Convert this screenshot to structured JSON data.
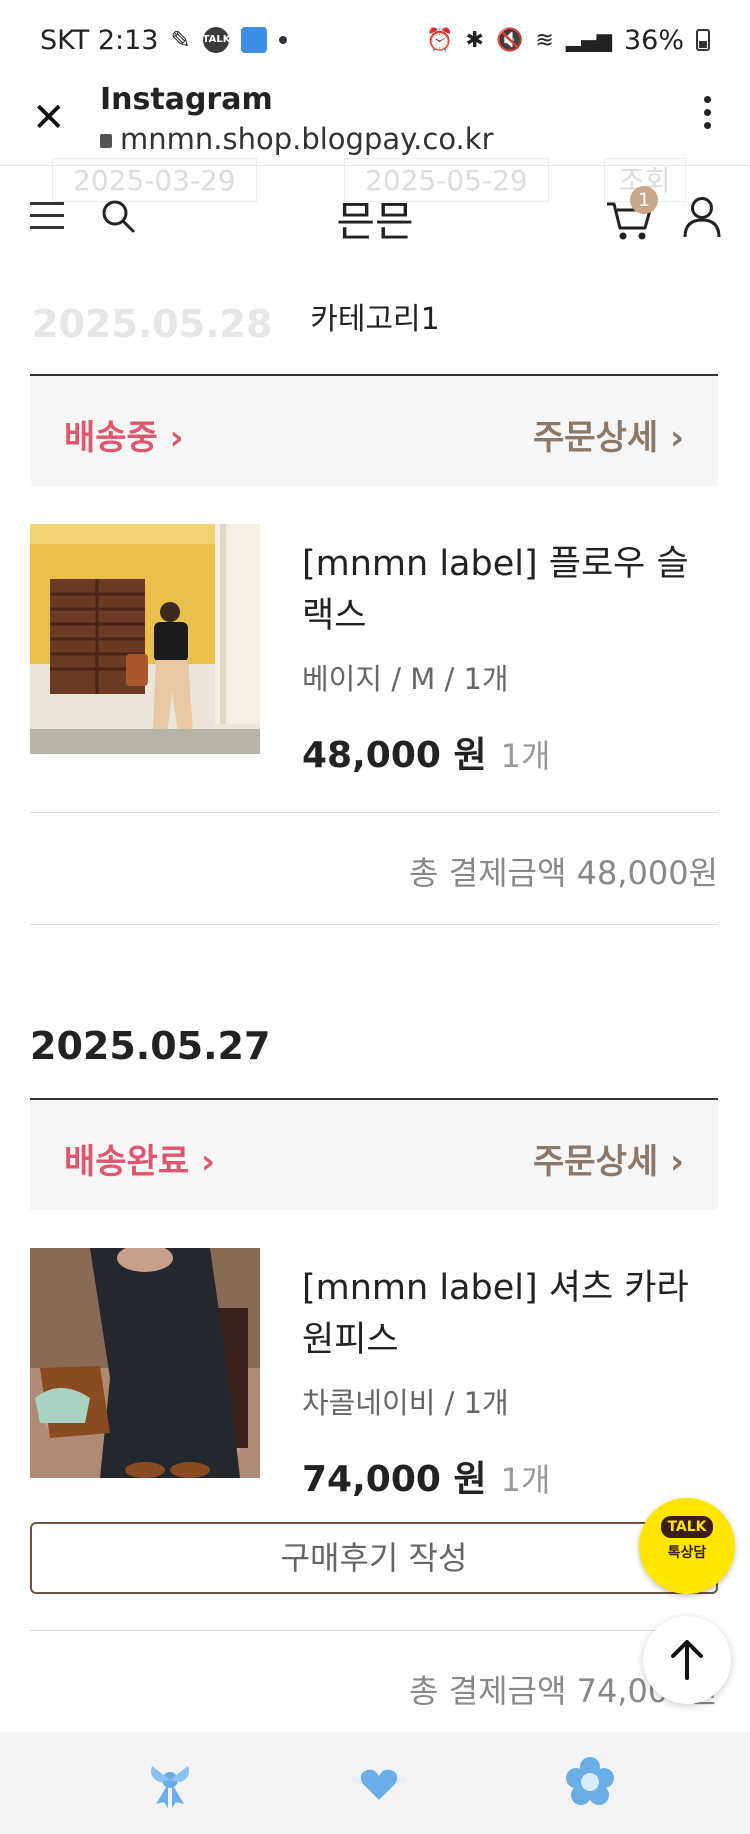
{
  "status_bar": {
    "carrier_time": "SKT 2:13",
    "talk_icon_text": "TALK",
    "battery": "36%"
  },
  "browser": {
    "title": "Instagram",
    "url": "mnmn.shop.blogpay.co.kr"
  },
  "shop": {
    "logo": "믄믄",
    "cart_count": "1",
    "category": "카테고리1",
    "search_date_from": "2025-03-29",
    "search_date_to": "2025-05-29",
    "search_button": "조회",
    "first_date": "2025.05.28"
  },
  "orders": [
    {
      "date": "2025.05.28",
      "status": "배송중",
      "detail_label": "주문상세",
      "product_name": "[mnmn label] 플로우 슬랙스",
      "option": "베이지 / M / 1개",
      "price": "48,000 원",
      "qty": "1개",
      "total": "총 결제금액 48,000원"
    },
    {
      "date": "2025.05.27",
      "status": "배송완료",
      "detail_label": "주문상세",
      "product_name": "[mnmn label] 셔츠 카라 원피스",
      "option": "차콜네이비 / 1개",
      "price": "74,000 원",
      "qty": "1개",
      "review_button": "구매후기 작성",
      "total": "총 결제금액 74,000원"
    }
  ],
  "floating": {
    "talk_bubble": "TALK",
    "talk_label": "톡상담"
  },
  "colors": {
    "status_pink": "#e0566e",
    "detail_brown": "#8d7766",
    "talk_yellow": "#ffe600",
    "bottom_icon_blue": "#6aaee8"
  }
}
